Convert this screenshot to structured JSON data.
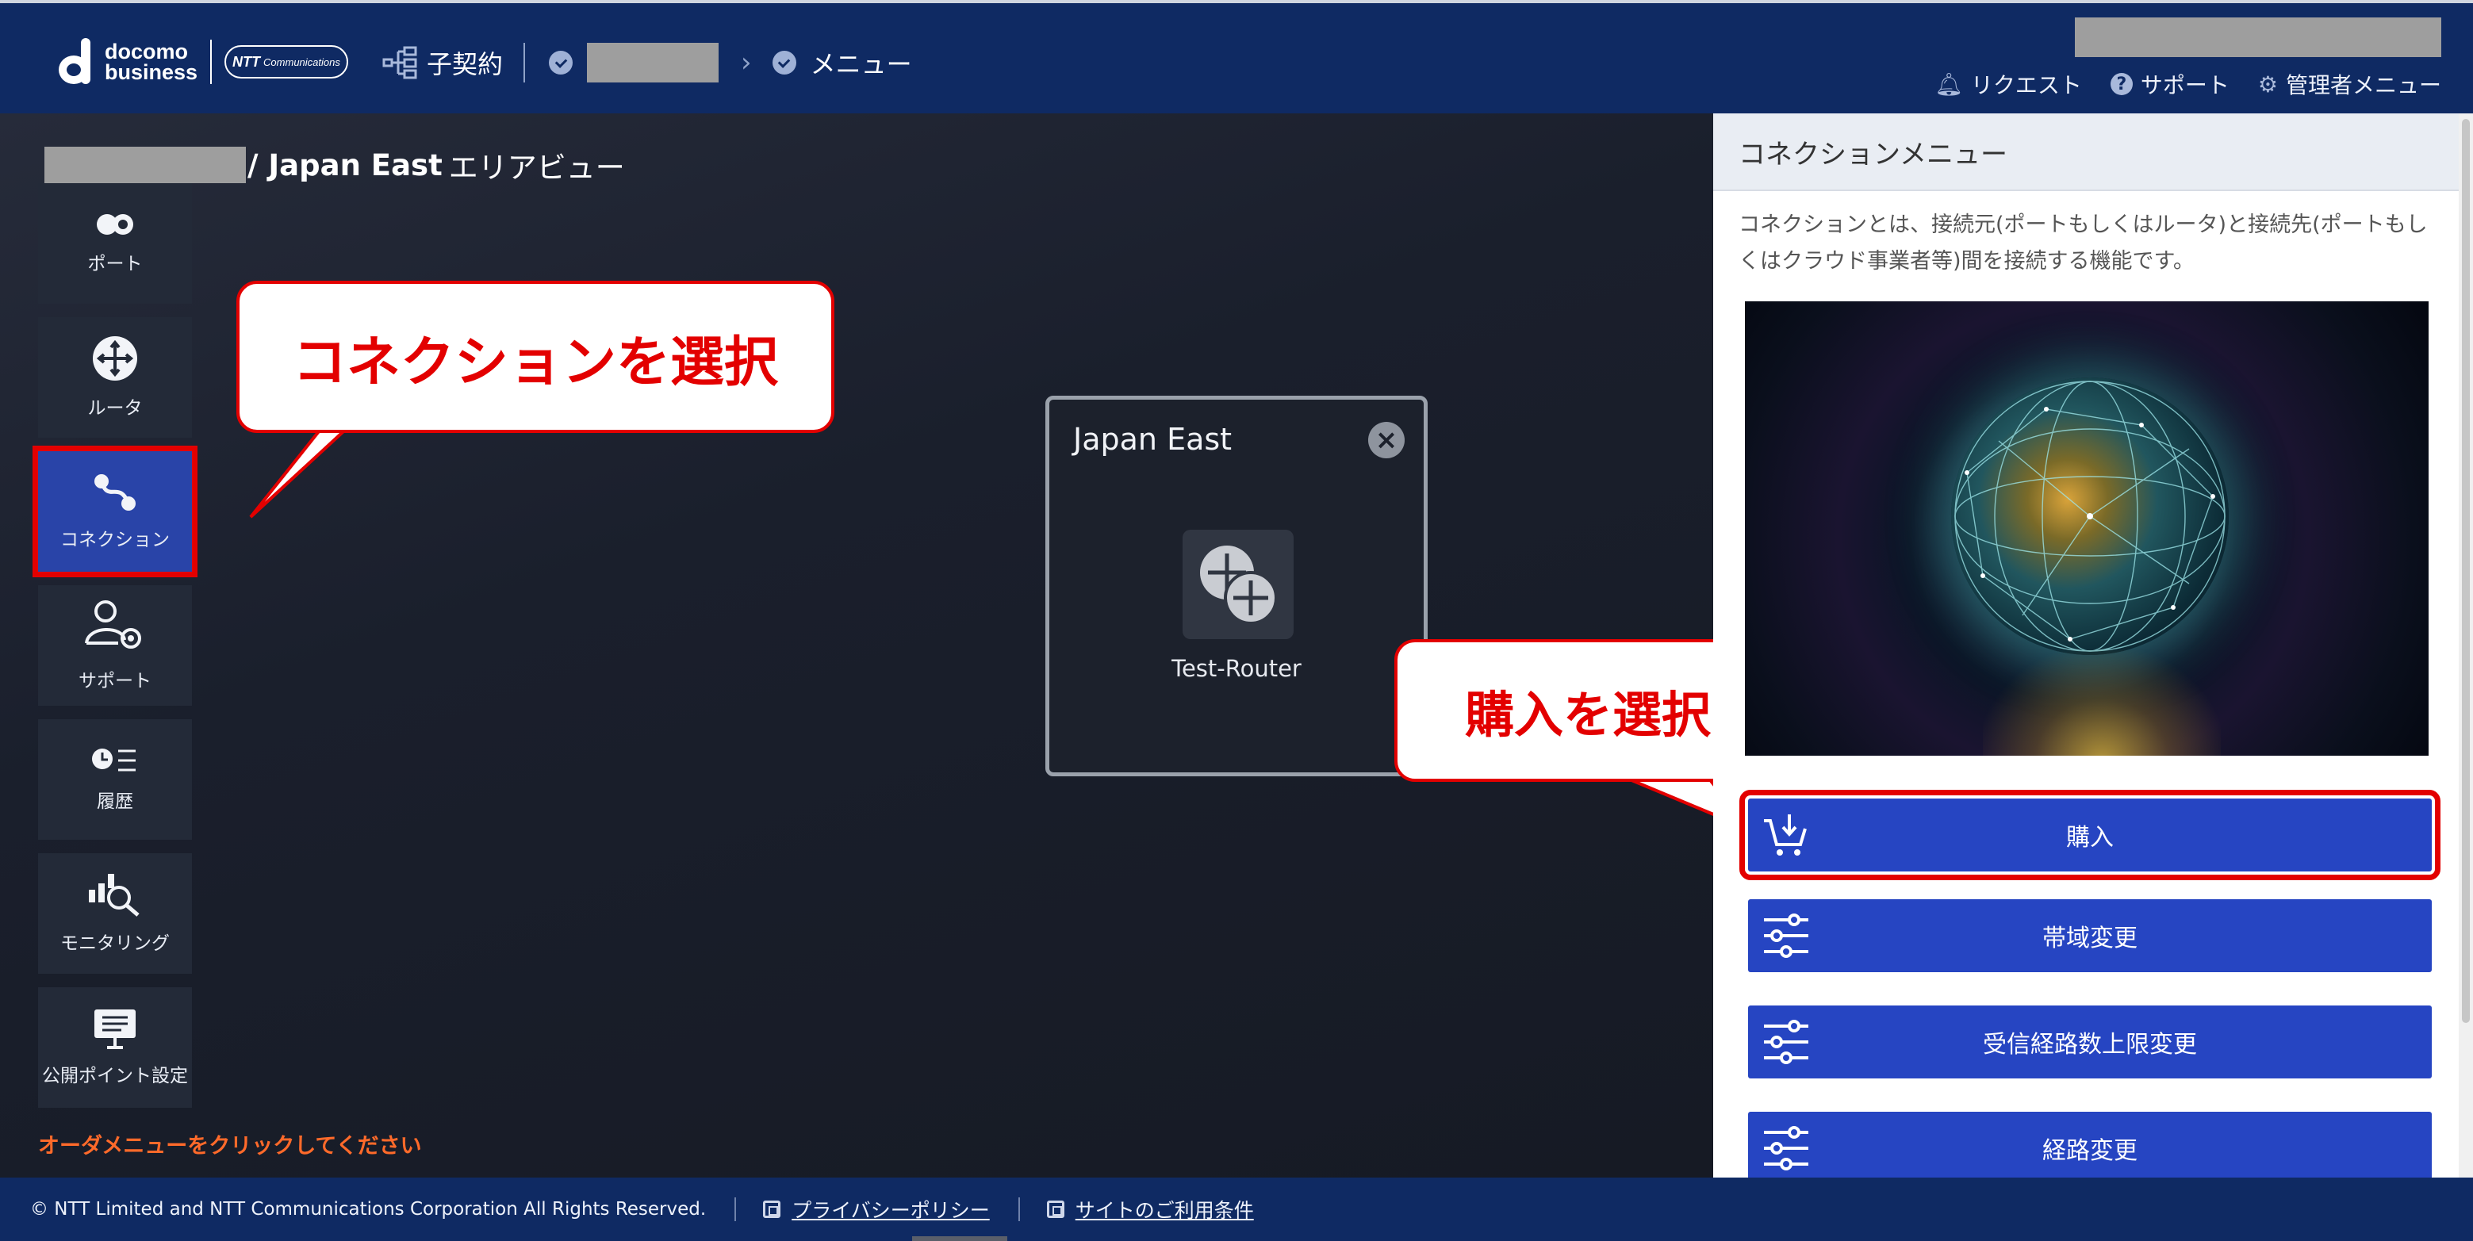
{
  "header": {
    "logo_line1": "docomo",
    "logo_line2": "business",
    "ntt_badge": "NTT",
    "ntt_badge_sub": "Communications",
    "contract_label": "子契約",
    "menu_label": "メニュー",
    "request_label": "リクエスト",
    "support_label": "サポート",
    "admin_label": "管理者メニュー"
  },
  "canvas": {
    "title_bold": "/ Japan East",
    "title_rest": "エリアビュー",
    "hint": "オーダメニューをクリックしてください"
  },
  "rail": {
    "items": [
      {
        "label": "ポート",
        "icon": "port-icon"
      },
      {
        "label": "ルータ",
        "icon": "router-icon"
      },
      {
        "label": "コネクション",
        "icon": "connection-icon"
      },
      {
        "label": "サポート",
        "icon": "support-user-icon"
      },
      {
        "label": "履歴",
        "icon": "history-icon"
      },
      {
        "label": "モニタリング",
        "icon": "monitoring-icon"
      },
      {
        "label": "公開ポイント設定",
        "icon": "public-point-icon"
      }
    ]
  },
  "annotations": {
    "callout_connection": "コネクションを選択",
    "callout_purchase": "購入を選択"
  },
  "region": {
    "title": "Japan East",
    "router_name": "Test-Router"
  },
  "panel": {
    "title": "コネクションメニュー",
    "description": "コネクションとは、接続元(ポートもしくはルータ)と接続先(ポートもしくはクラウド事業者等)間を接続する機能です。",
    "buttons": {
      "purchase": "購入",
      "bandwidth": "帯域変更",
      "rx_route_limit": "受信経路数上限変更",
      "route_change": "経路変更"
    }
  },
  "footer": {
    "copyright": "© NTT Limited and NTT Communications Corporation All Rights Reserved.",
    "privacy": "プライバシーポリシー",
    "terms": "サイトのご利用条件"
  },
  "colors": {
    "header_bg": "#0f2a63",
    "accent_blue": "#2645c2",
    "highlight_red": "#e30000",
    "hint_orange": "#ff6a2a"
  }
}
